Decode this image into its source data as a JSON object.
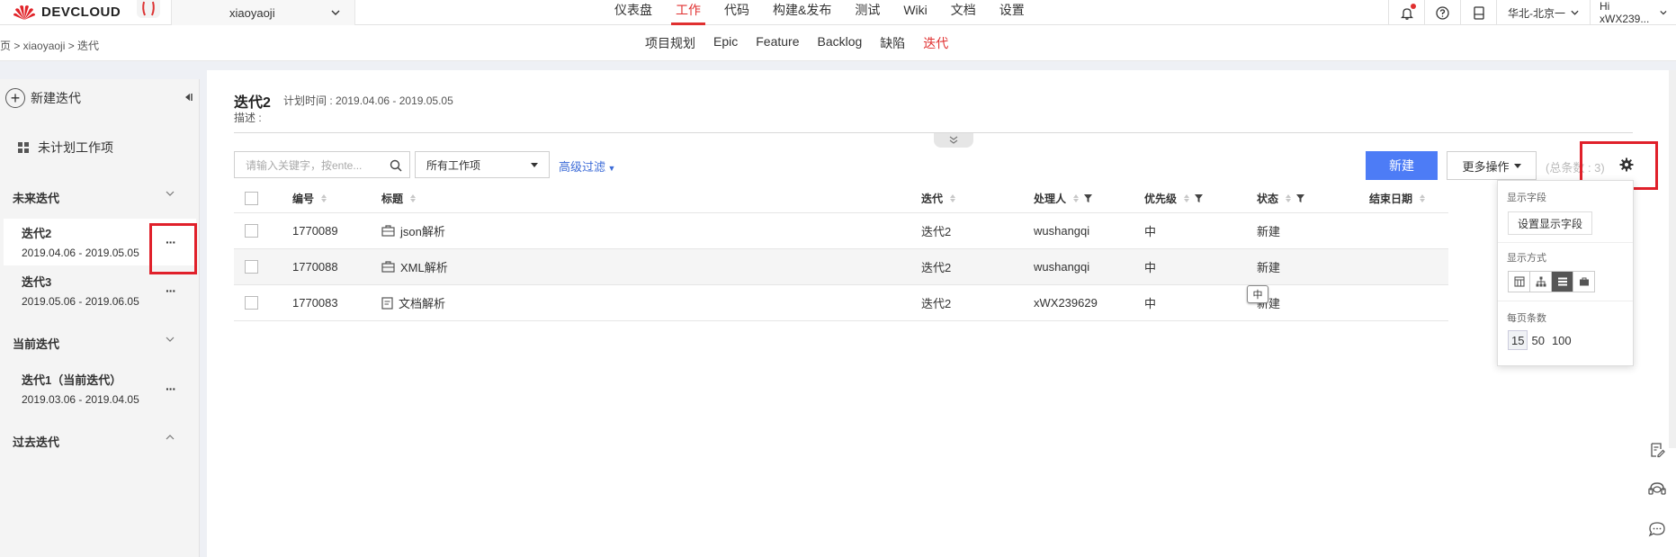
{
  "app": {
    "logo_text": "DEVCLOUD",
    "project_name": "xiaoyaoji"
  },
  "main_nav": [
    {
      "label": "仪表盘",
      "active": false
    },
    {
      "label": "工作",
      "active": true
    },
    {
      "label": "代码",
      "active": false
    },
    {
      "label": "构建&发布",
      "active": false
    },
    {
      "label": "测试",
      "active": false
    },
    {
      "label": "Wiki",
      "active": false
    },
    {
      "label": "文档",
      "active": false
    },
    {
      "label": "设置",
      "active": false
    }
  ],
  "top_right": {
    "region": "华北-北京一",
    "user": "Hi xWX239..."
  },
  "breadcrumb": "页 > xiaoyaoji > 迭代",
  "sub_nav": [
    {
      "label": "项目规划",
      "active": false
    },
    {
      "label": "Epic",
      "active": false
    },
    {
      "label": "Feature",
      "active": false
    },
    {
      "label": "Backlog",
      "active": false
    },
    {
      "label": "缺陷",
      "active": false
    },
    {
      "label": "迭代",
      "active": true
    }
  ],
  "sidebar": {
    "new_label": "新建迭代",
    "unplanned_label": "未计划工作项",
    "groups": {
      "future": "未来迭代",
      "current": "当前迭代",
      "past": "过去迭代"
    },
    "future_items": [
      {
        "title": "迭代2",
        "dates": "2019.04.06 - 2019.05.05",
        "more": "···"
      },
      {
        "title": "迭代3",
        "dates": "2019.05.06 - 2019.06.05",
        "more": "···"
      }
    ],
    "current_items": [
      {
        "title": "迭代1（当前迭代）",
        "dates": "2019.03.06 - 2019.04.05",
        "more": "···"
      }
    ]
  },
  "iteration": {
    "title": "迭代2",
    "plan_time": "计划时间 : 2019.04.06 - 2019.05.05",
    "desc": "描述 :"
  },
  "toolbar": {
    "search_placeholder": "请输入关键字，按ente...",
    "type_select": "所有工作项",
    "adv_filter": "高级过滤",
    "new_button": "新建",
    "more_button": "更多操作",
    "total": "(总条数 : 3)"
  },
  "table": {
    "headers": [
      "编号",
      "标题",
      "迭代",
      "处理人",
      "优先级",
      "状态",
      "结束日期"
    ],
    "rows": [
      {
        "id": "1770089",
        "title": "json解析",
        "iter": "迭代2",
        "owner": "wushangqi",
        "priority": "中",
        "status": "新建",
        "end": ""
      },
      {
        "id": "1770088",
        "title": "XML解析",
        "iter": "迭代2",
        "owner": "wushangqi",
        "priority": "中",
        "status": "新建",
        "end": ""
      },
      {
        "id": "1770083",
        "title": "文档解析",
        "iter": "迭代2",
        "owner": "xWX239629",
        "priority": "中",
        "status": "新建",
        "end": ""
      }
    ]
  },
  "tooltip": "中",
  "settings_popup": {
    "fields_label": "显示字段",
    "fields_button": "设置显示字段",
    "mode_label": "显示方式",
    "page_label": "每页条数",
    "page_sizes": [
      "15",
      "50",
      "100"
    ]
  },
  "colors": {
    "accent_red": "#e03030",
    "primary_blue": "#4d7cf6",
    "highlight_box": "#e0202a"
  }
}
